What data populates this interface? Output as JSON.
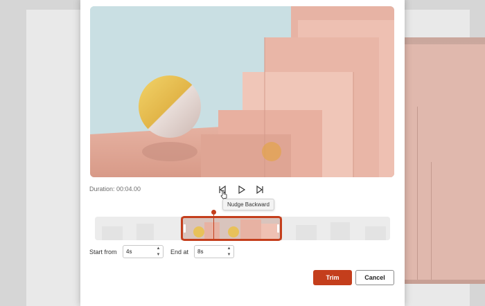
{
  "dialog": {
    "duration_text": "Duration: 00:04.00",
    "tooltip_text": "Nudge Backward",
    "start_label": "Start from",
    "start_value": "4s",
    "end_label": "End at",
    "end_value": "8s",
    "trim_label": "Trim",
    "cancel_label": "Cancel"
  },
  "colors": {
    "accent": "#c43e1c"
  }
}
